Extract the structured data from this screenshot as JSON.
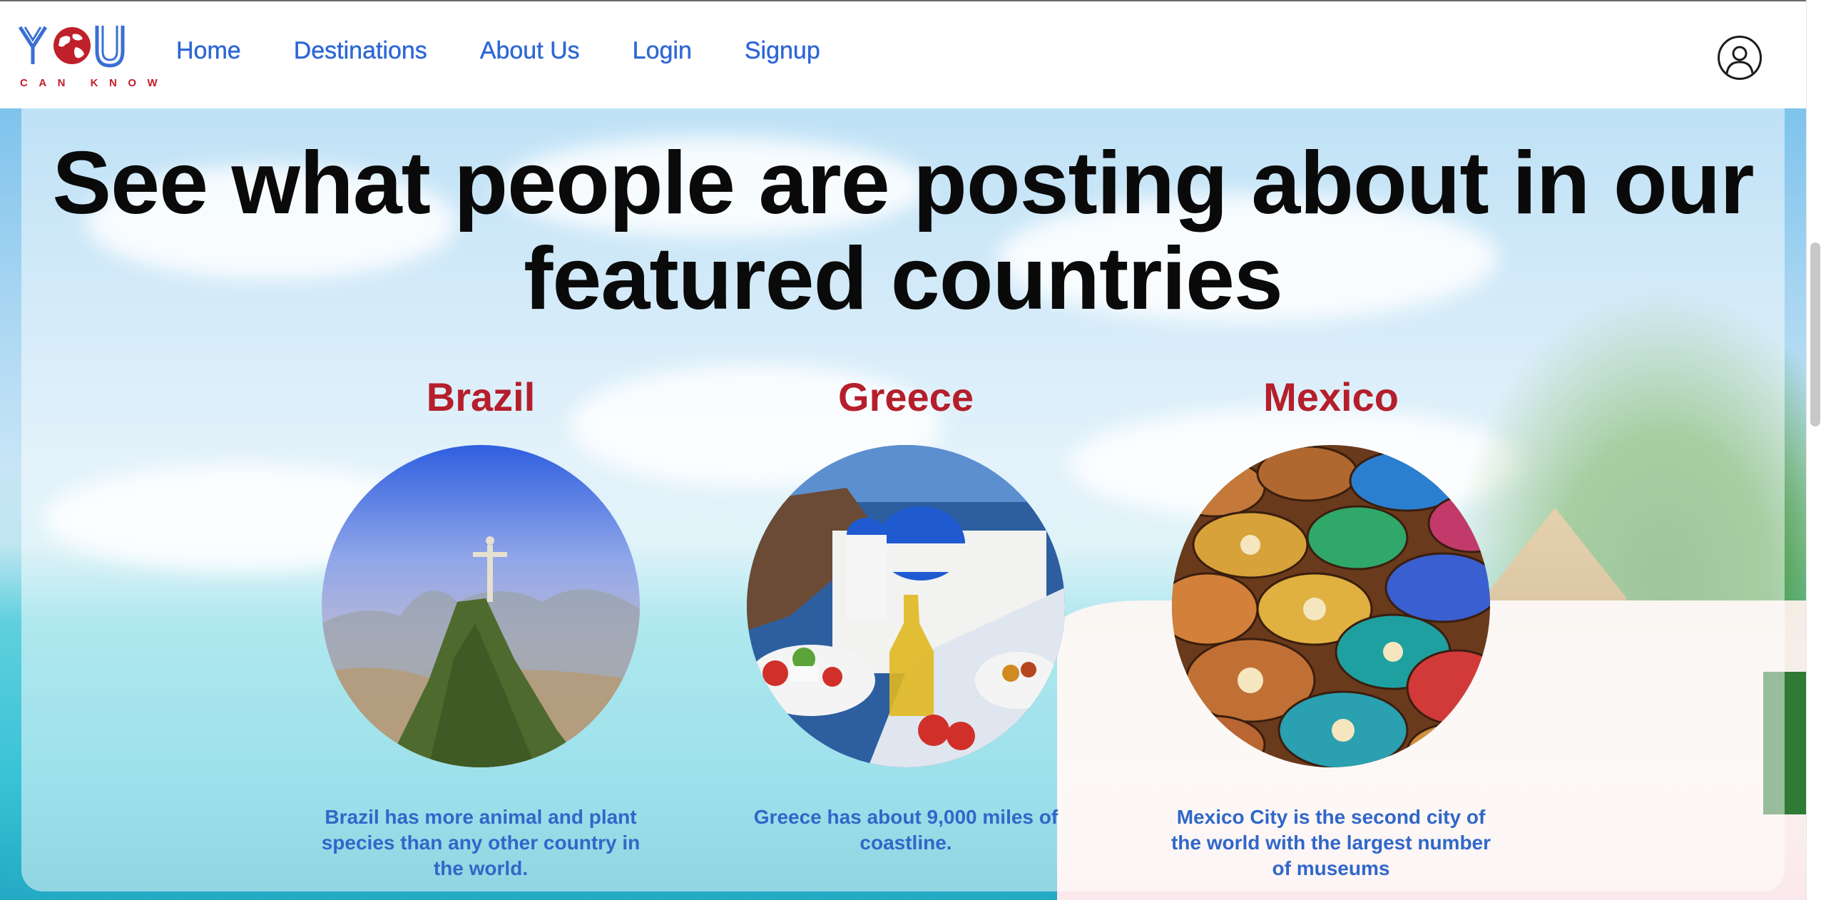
{
  "logo": {
    "main": "YOU",
    "sub": "CAN KNOW",
    "icon": "globe-icon"
  },
  "nav": {
    "links": [
      "Home",
      "Destinations",
      "About Us",
      "Login",
      "Signup"
    ],
    "user_icon": "user-profile-icon"
  },
  "colors": {
    "brand_blue": "#2d66d6",
    "brand_red": "#b51e2b",
    "fact_blue": "#3067c9"
  },
  "main": {
    "headline": "See what people are posting about in our featured countries",
    "countries": [
      {
        "name": "Brazil",
        "image": "christ-the-redeemer-rio-photo",
        "fact": "Brazil has more animal and plant species than any other country in the world."
      },
      {
        "name": "Greece",
        "image": "santorini-greek-salad-photo",
        "fact": "Greece has about 9,000 miles of coastline."
      },
      {
        "name": "Mexico",
        "image": "painted-clay-bowls-photo",
        "fact": "Mexico City is the second city of the world with the largest number of museums"
      }
    ]
  }
}
